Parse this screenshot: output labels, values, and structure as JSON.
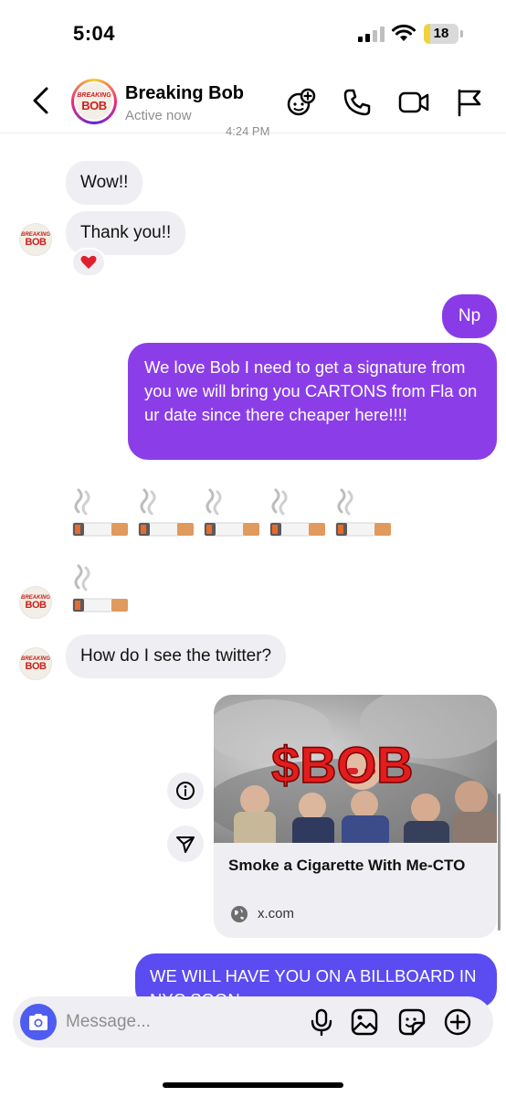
{
  "status_bar": {
    "time": "5:04",
    "battery": "18",
    "battery_level": 0.18
  },
  "header": {
    "name": "Breaking Bob",
    "status": "Active now"
  },
  "avatar": {
    "logo_top": "BREAKING",
    "logo_main": "BOB"
  },
  "messages": {
    "time_peek": "4:24 PM",
    "in_1": "Wow!!",
    "in_2": "Thank you!!",
    "reaction": "❤️",
    "out_1": "Np",
    "out_2": "We love Bob I need to get a signature from you we will bring you CARTONS from Fla on ur date since there cheaper here!!!!",
    "in_3": "How do I see the twitter?",
    "out_3": "WE WILL HAVE YOU ON A BILLBOARD IN NYC SOON"
  },
  "link_card": {
    "image_overlay": "$BOB",
    "title": "Smoke a Cigarette With Me-CTO",
    "domain": "x.com"
  },
  "composer": {
    "placeholder": "Message..."
  },
  "colors": {
    "purple": "#8a3be8",
    "indigo": "#5a4cf0",
    "bubble_gray": "#efeff3",
    "camera_blue": "#4f5cf0"
  },
  "icons": [
    "back-chevron-icon",
    "add-effect-icon",
    "phone-icon",
    "video-icon",
    "flag-icon",
    "heart-icon",
    "cigarette-icon",
    "info-icon",
    "share-icon",
    "globe-icon",
    "camera-icon",
    "microphone-icon",
    "gallery-icon",
    "sticker-icon",
    "plus-icon"
  ]
}
